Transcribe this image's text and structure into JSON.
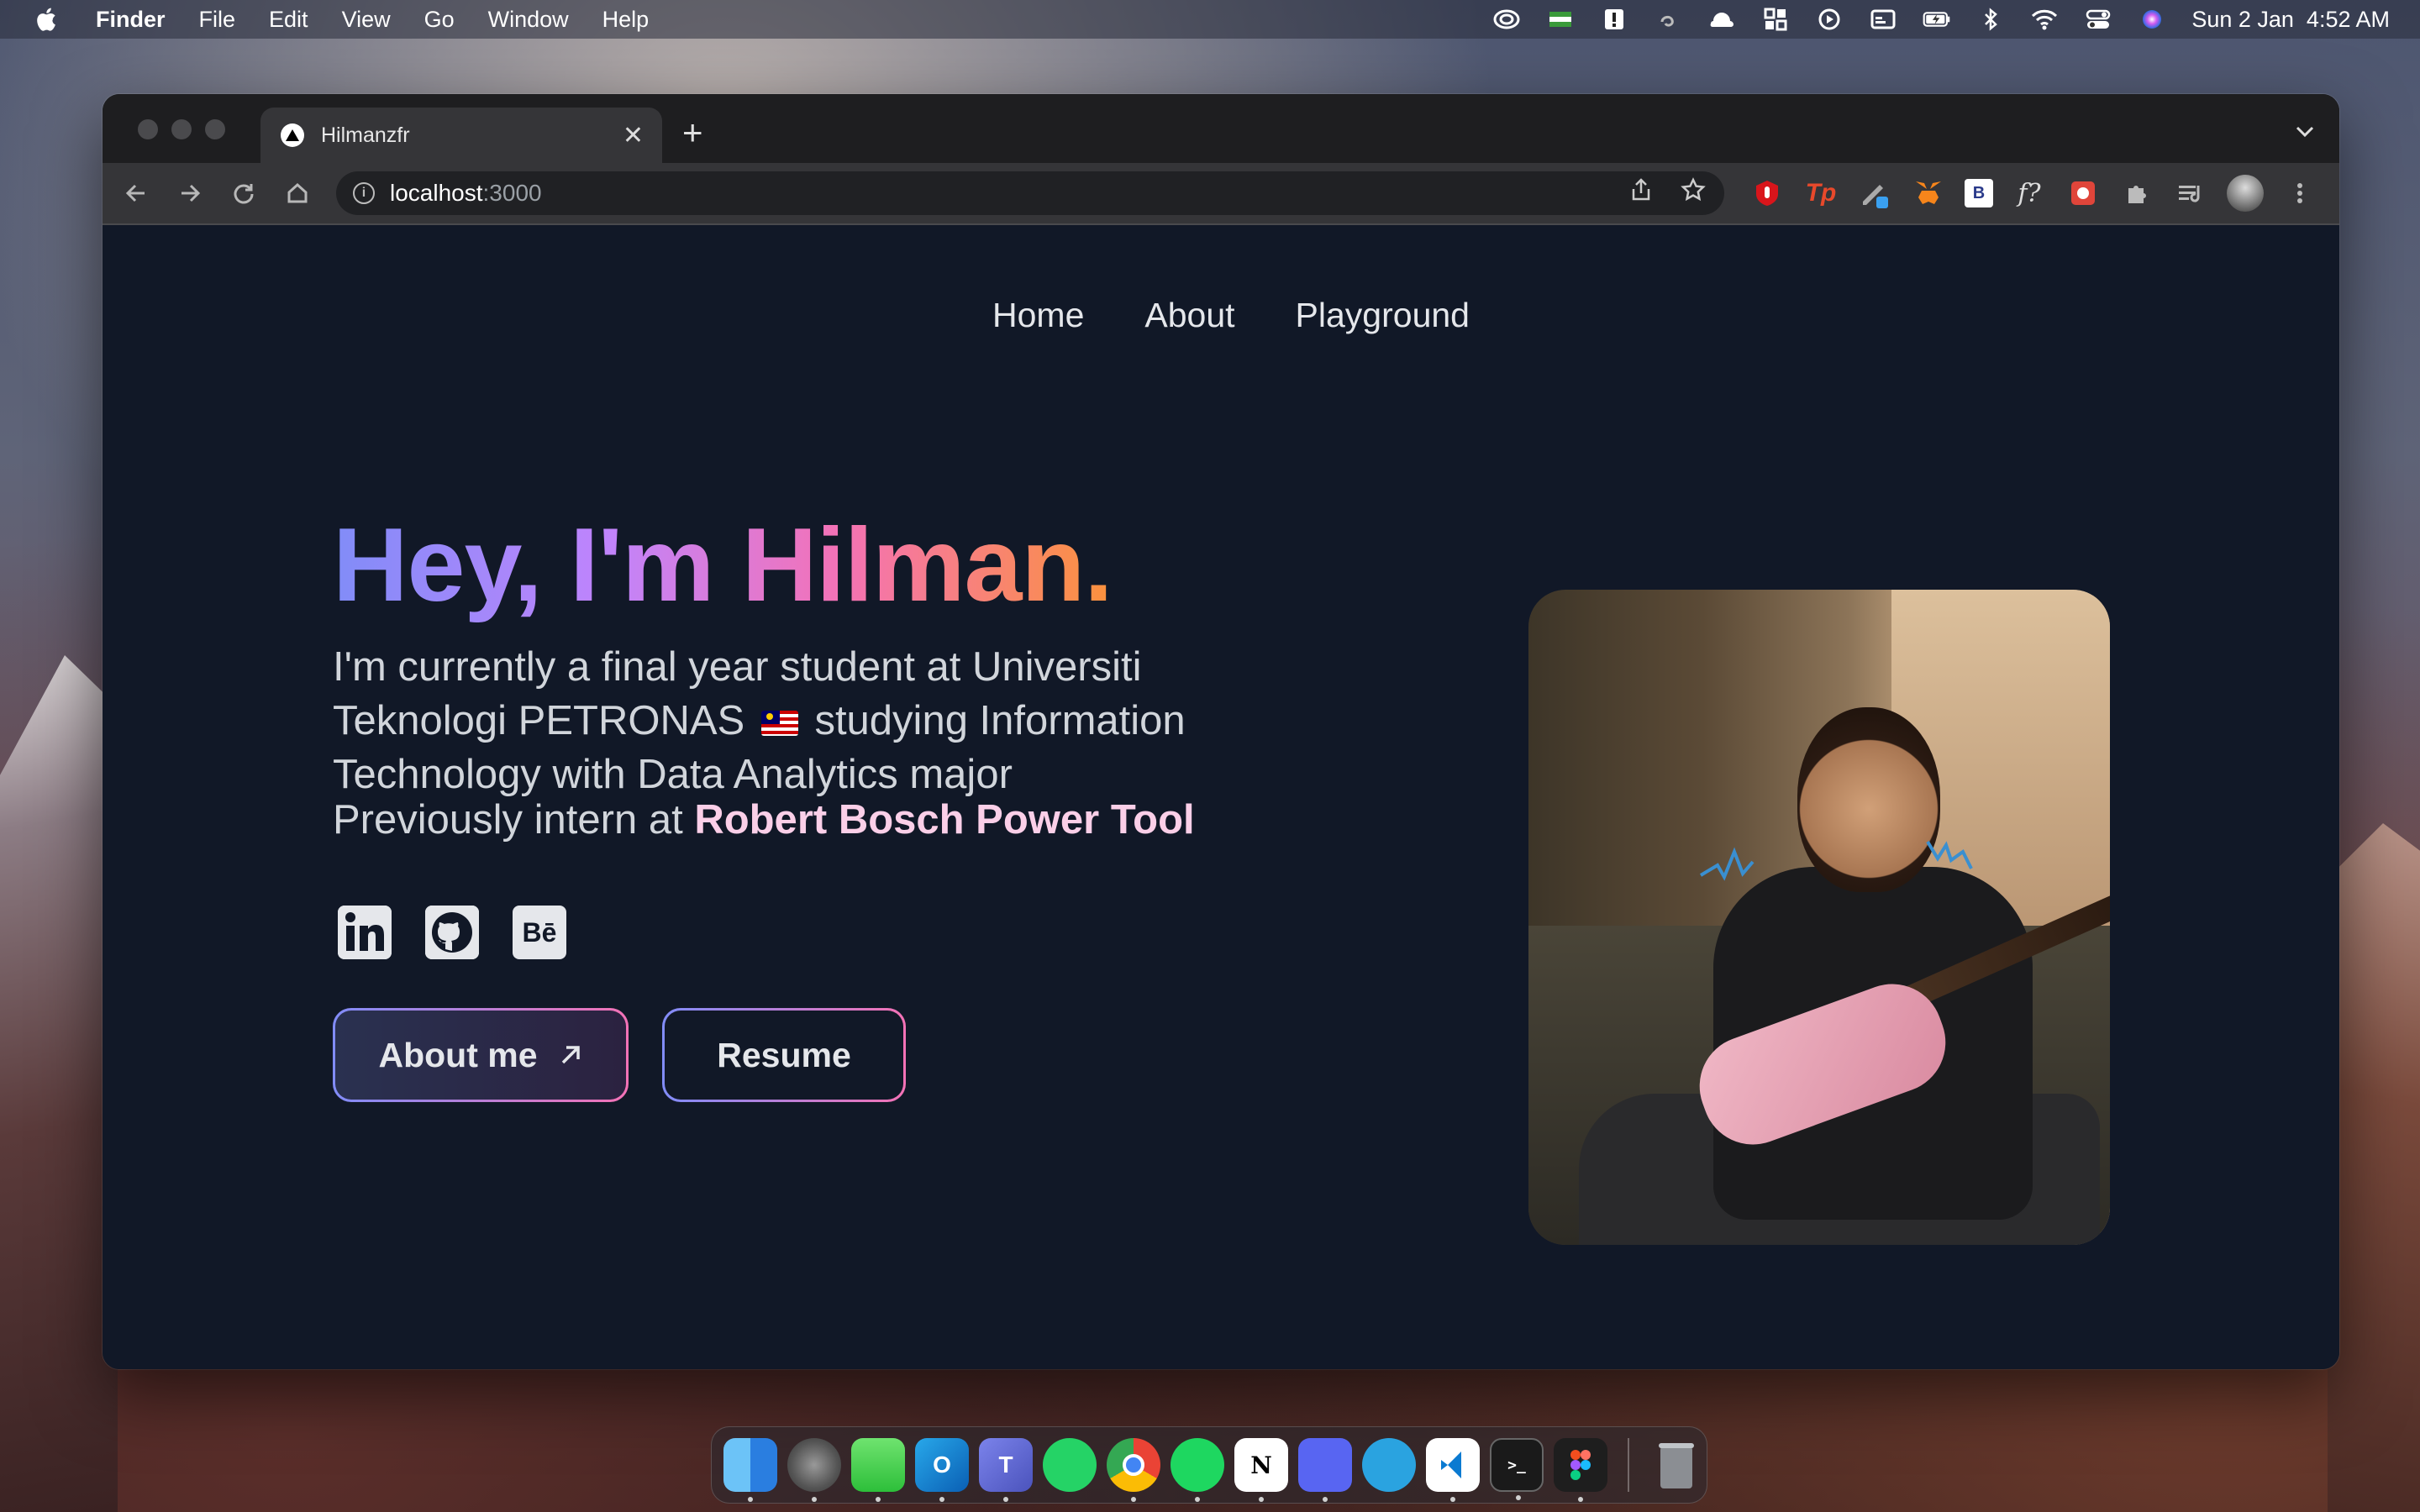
{
  "menubar": {
    "app_name": "Finder",
    "menus": [
      "File",
      "Edit",
      "View",
      "Go",
      "Window",
      "Help"
    ],
    "clock": "Sun 2 Jan  4:52 AM"
  },
  "browser": {
    "tab_title": "Hilmanzfr",
    "url_host": "localhost",
    "url_port": ":3000",
    "extensions": [
      "ublock-icon",
      "tp-icon",
      "pen-icon",
      "metamask-icon",
      "b-icon",
      "f-icon",
      "gift-icon",
      "puzzle-icon",
      "playlist-icon",
      "profile-avatar"
    ]
  },
  "site": {
    "nav": [
      "Home",
      "About",
      "Playground"
    ],
    "hero_title": "Hey, I'm Hilman.",
    "desc_part1": "I'm currently a final year student at Universiti Teknologi PETRONAS",
    "desc_part2": " studying Information Technology with Data Analytics major",
    "intern_prefix": "Previously intern at ",
    "intern_company": "Robert Bosch Power Tool",
    "social_behance": "Bē",
    "btn_about": "About me",
    "btn_resume": "Resume"
  },
  "colors": {
    "page_bg": "#111827",
    "gradient": [
      "#818cf8",
      "#c084fc",
      "#f472b6",
      "#fb923c"
    ],
    "company_pink": "#fbcfe8"
  },
  "dock": [
    "finder",
    "system-preferences",
    "messages",
    "outlook",
    "teams",
    "whatsapp",
    "chrome",
    "spotify",
    "notion",
    "discord",
    "telegram",
    "vscode",
    "terminal",
    "figma",
    "trash"
  ]
}
